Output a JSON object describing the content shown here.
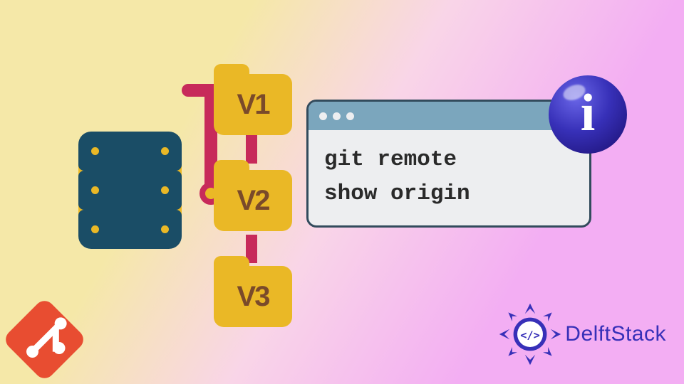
{
  "folders": {
    "v1": "V1",
    "v2": "V2",
    "v3": "V3"
  },
  "terminal": {
    "line1": "git remote",
    "line2": "show origin"
  },
  "info_glyph": "i",
  "brand": {
    "name": "DelftStack",
    "code_glyph": "</>"
  },
  "colors": {
    "server": "#1a4d66",
    "folder": "#EAB826",
    "connector": "#c72a5a",
    "git": "#e84d31",
    "info_orb": "#3730b8"
  }
}
